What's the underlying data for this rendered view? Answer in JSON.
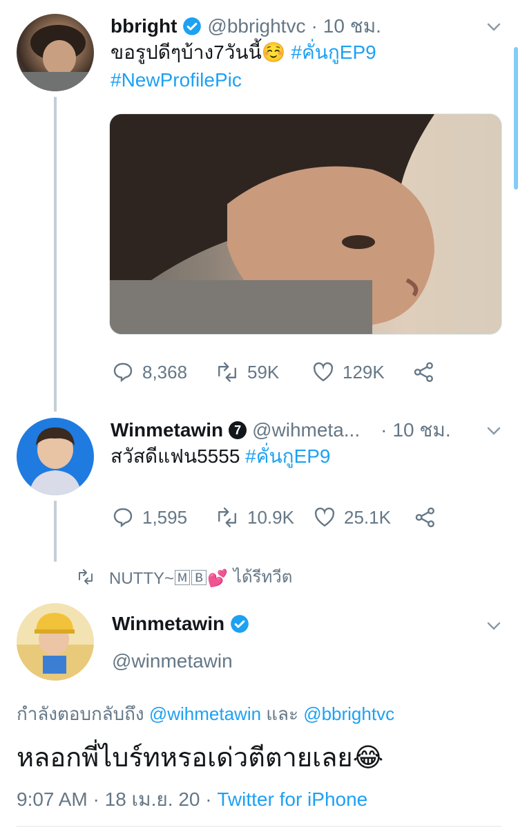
{
  "tweet1": {
    "name": "bbright",
    "handle": "@bbrightvc",
    "time": "10 ชม.",
    "text": "ขอรูปดีๆบ้าง7วันนี้☺️",
    "hashtag1": "#คั่นกูEP9",
    "hashtag2": "#NewProfilePic",
    "replies": "8,368",
    "retweets": "59K",
    "likes": "129K"
  },
  "tweet2": {
    "name": "Winmetawin",
    "badge": "7",
    "handle": "@wihmeta...",
    "time": "10 ชม.",
    "text": "สวัสดีแฟน5555",
    "hashtag": "#คั่นกูEP9",
    "replies": "1,595",
    "retweets": "10.9K",
    "likes": "25.1K"
  },
  "retweet_bar": {
    "user": "NUTTY~🄼🄱💕",
    "action": "ได้รีทวีต"
  },
  "main_tweet": {
    "name": "Winmetawin",
    "handle": "@winmetawin",
    "replying_prefix": "กำลังตอบกลับถึง",
    "reply_to_1": "@wihmetawin",
    "reply_and": "และ",
    "reply_to_2": "@bbrightvc",
    "text": "หลอกพี่ไบร์ทหรอเด่วตีตายเลย😂",
    "time": "9:07 AM",
    "date": "18 เม.ย. 20",
    "source": "Twitter for iPhone"
  },
  "colors": {
    "accent": "#1da1f2",
    "secondary_text": "#657786",
    "primary_text": "#14171a",
    "thread_line": "#c4cfd6"
  }
}
